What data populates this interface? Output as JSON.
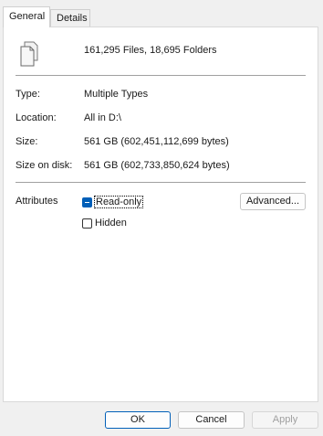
{
  "tabs": [
    {
      "label": "General",
      "active": true
    },
    {
      "label": "Details",
      "active": false
    }
  ],
  "summary": "161,295 Files, 18,695 Folders",
  "icon": "multiple-files-icon",
  "properties": [
    {
      "label": "Type:",
      "value": "Multiple Types"
    },
    {
      "label": "Location:",
      "value": "All in D:\\"
    },
    {
      "label": "Size:",
      "value": "561 GB (602,451,112,699 bytes)"
    },
    {
      "label": "Size on disk:",
      "value": "561 GB (602,733,850,624 bytes)"
    }
  ],
  "attributes": {
    "label": "Attributes",
    "read_only": {
      "label": "Read-only",
      "state": "indeterminate"
    },
    "hidden": {
      "label": "Hidden",
      "state": "unchecked"
    },
    "advanced_button": "Advanced..."
  },
  "buttons": {
    "ok": "OK",
    "cancel": "Cancel",
    "apply": "Apply"
  },
  "colors": {
    "accent": "#005fb8",
    "panel": "#ffffff",
    "background": "#f0f0f0"
  }
}
